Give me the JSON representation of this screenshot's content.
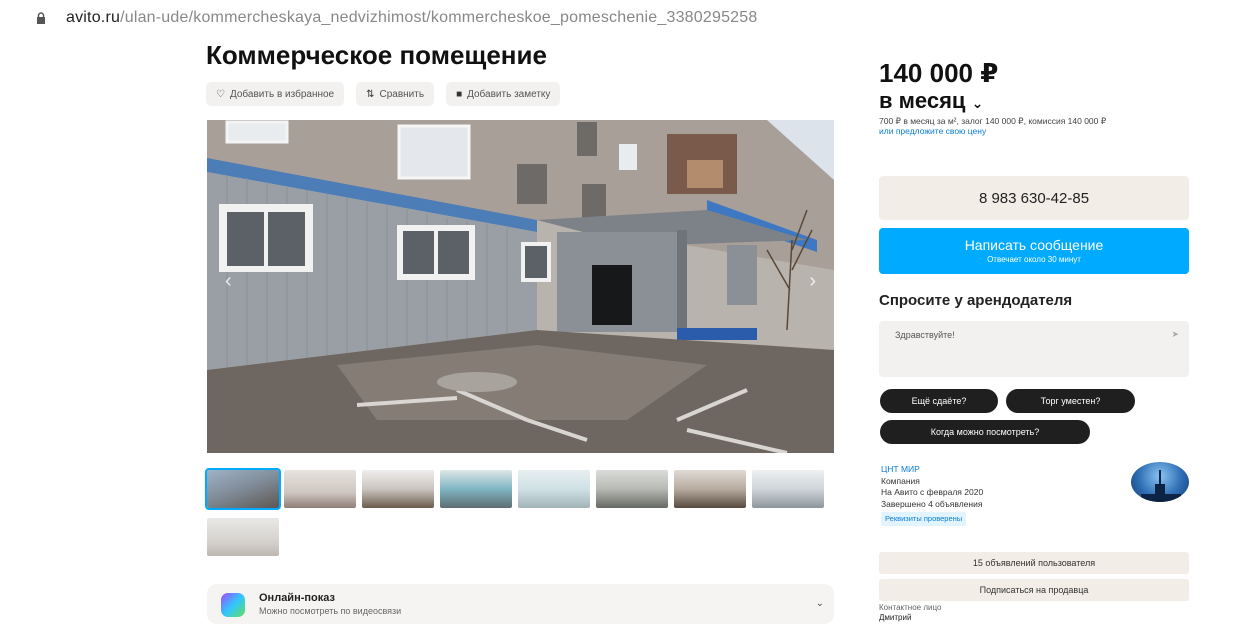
{
  "browser": {
    "url_host": "avito.ru",
    "url_path": "/ulan-ude/kommercheskaya_nedvizhimost/kommercheskoe_pomeschenie_3380295258"
  },
  "listing": {
    "title": "Коммерческое помещение",
    "actions": [
      {
        "icon": "heart-icon",
        "label": "Добавить в избранное"
      },
      {
        "icon": "compare-icon",
        "label": "Сравнить"
      },
      {
        "icon": "note-icon",
        "label": "Добавить заметку"
      }
    ],
    "thumbnail_count": 9
  },
  "online_show": {
    "title": "Онлайн-показ",
    "subtitle": "Можно посмотреть по видеосвязи"
  },
  "pricing": {
    "price": "140 000 ₽",
    "period": "в месяц",
    "details": "700 ₽ в месяц за м², залог 140 000 ₽, комиссия 140 000 ₽",
    "link": "или предложите свою цену"
  },
  "contact": {
    "phone": "8 983 630-42-85",
    "message_button": "Написать сообщение",
    "message_sub": "Отвечает около 30 минут"
  },
  "ask": {
    "title": "Спросите у арендодателя",
    "placeholder": "Здравствуйте!",
    "chips": [
      "Ещё сдаёте?",
      "Торг уместен?",
      "Когда можно посмотреть?"
    ]
  },
  "seller": {
    "name": "ЦНТ МИР",
    "type": "Компания",
    "since": "На Авито с февраля 2020",
    "completed": "Завершено 4 объявления",
    "badge": "Реквизиты проверены",
    "ads_button": "15 объявлений пользователя",
    "subscribe_button": "Подписаться на продавца",
    "contact_label": "Контактное лицо",
    "contact_name": "Дмитрий"
  },
  "colors": {
    "accent": "#00aaff",
    "chip": "#1f1f1f",
    "phone_bg": "#f2ede6"
  }
}
